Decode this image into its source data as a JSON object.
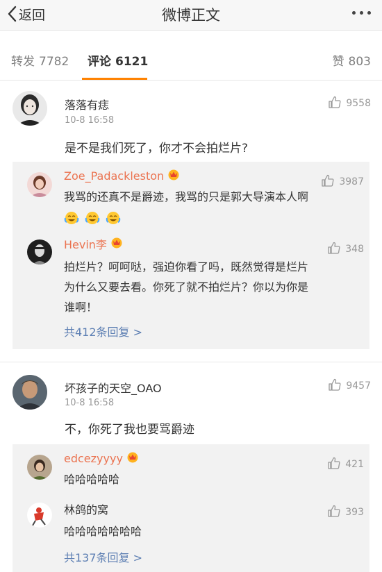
{
  "nav": {
    "back_label": "返回",
    "title": "微博正文"
  },
  "tabs": {
    "repost": {
      "label": "转发",
      "count": "7782"
    },
    "comment": {
      "label": "评论",
      "count": "6121"
    },
    "like": {
      "label": "赞",
      "count": "803"
    }
  },
  "colors": {
    "accent": "#ff8200",
    "username": "#eb7350",
    "link": "#5d7fb3",
    "reply_bg": "#f2f2f2"
  },
  "comments": [
    {
      "user": "落落有痣",
      "time": "10-8 16:58",
      "likes": "9558",
      "text": "是不是我们死了，你才不会拍烂片?",
      "replies": [
        {
          "user": "Zoe_Padackleston",
          "likes": "3987",
          "text": "我骂的还真不是爵迹，我骂的只是郭大导演本人啊",
          "emoji_count": 3,
          "emoji": "crying-laugh-icon"
        },
        {
          "user": "Hevin李",
          "likes": "348",
          "text_lines": [
            "拍烂片？呵呵哒，强迫你看了吗，既然觉得是烂片",
            "为什么又要去看。你死了就不拍烂片？你以为你是",
            "谁啊！"
          ]
        }
      ],
      "more_replies": "共412条回复 >"
    },
    {
      "user": "坏孩子的天空_OAO",
      "time": "10-8 16:58",
      "likes": "9457",
      "text": "不，你死了我也要骂爵迹",
      "replies": [
        {
          "user": "edcezyyyy",
          "likes": "421",
          "text": "哈哈哈哈哈"
        },
        {
          "user": "林鸽的窝",
          "likes": "393",
          "text": "哈哈哈哈哈哈哈"
        }
      ],
      "more_replies": "共137条回复 >"
    }
  ]
}
